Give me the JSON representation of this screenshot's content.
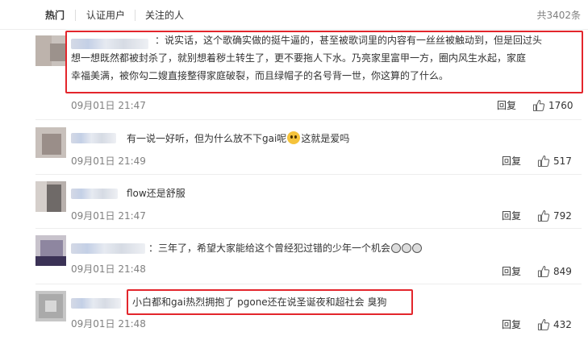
{
  "tabs": {
    "hot": "热门",
    "verified": "认证用户",
    "following": "关注的人"
  },
  "total_count": "共3402条",
  "icons": {
    "like": "thumbs-up-icon",
    "emoji": "emoji-icon"
  },
  "colors": {
    "highlight": "#e3262c",
    "meta": "#808080"
  },
  "comments": [
    {
      "text_lines": [
        "：说实话，这个歌确实做的挺牛逼的，甚至被歌词里的内容有一丝丝被触动到，但是回过头",
        "想一想既然都被封杀了，就别想着秽土转生了，更不要拖人下水。乃亮家里富甲一方，圈内风生水起，家庭",
        "幸福美满，被你勾二嫂直接整得家庭破裂，而且绿帽子的名号背一世，你这算的了什么。"
      ],
      "time": "09月01日 21:47",
      "reply": "回复",
      "likes": "1760"
    },
    {
      "text_before": "有一说一好听，但为什么放不下gai呢",
      "text_after": "这就是爱吗",
      "time": "09月01日 21:49",
      "reply": "回复",
      "likes": "517"
    },
    {
      "text": "flow还是舒服",
      "time": "09月01日 21:47",
      "reply": "回复",
      "likes": "792"
    },
    {
      "text": "：三年了，希望大家能给这个曾经犯过错的少年一个机会",
      "time": "09月01日 21:48",
      "reply": "回复",
      "likes": "849"
    },
    {
      "text": "小白都和gai热烈拥抱了 pgone还在说圣诞夜和超社会 臭狗",
      "time": "09月01日 21:48",
      "reply": "回复",
      "likes": "432"
    }
  ]
}
